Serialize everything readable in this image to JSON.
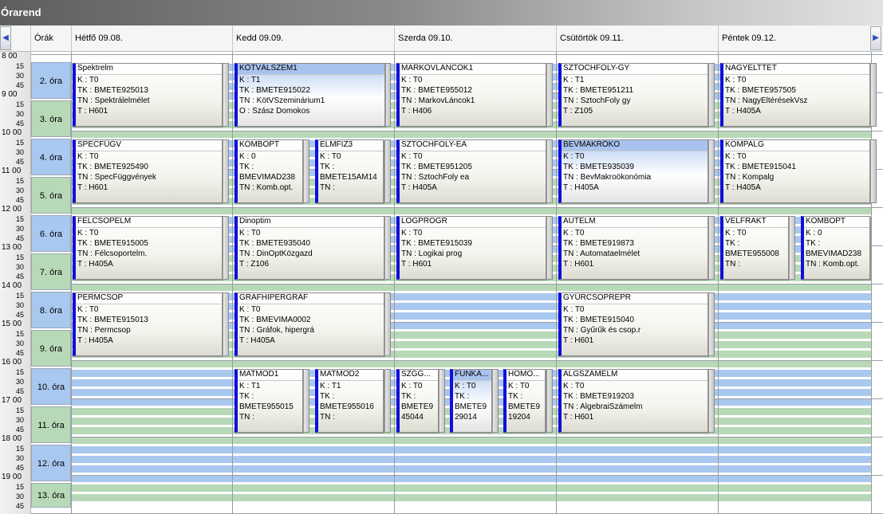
{
  "window": {
    "title": "Órarend"
  },
  "nav": {
    "prev_icon": "◀",
    "next_icon": "▶"
  },
  "header": {
    "corner": "Órák",
    "days": [
      "Hétfő  09.08.",
      "Kedd  09.09.",
      "Szerda  09.10.",
      "Csütörtök  09.11.",
      "Péntek  09.12."
    ]
  },
  "time_labels": [
    {
      "label": "8 00",
      "sub": [
        "15",
        "30",
        "45"
      ]
    },
    {
      "label": "9 00",
      "sub": [
        "15",
        "30",
        "45"
      ]
    },
    {
      "label": "10 00",
      "sub": [
        "15",
        "30",
        "45"
      ]
    },
    {
      "label": "11 00",
      "sub": [
        "15",
        "30",
        "45"
      ]
    },
    {
      "label": "12 00",
      "sub": [
        "15",
        "30",
        "45"
      ]
    },
    {
      "label": "13 00",
      "sub": [
        "15",
        "30",
        "45"
      ]
    },
    {
      "label": "14 00",
      "sub": [
        "15",
        "30",
        "45"
      ]
    },
    {
      "label": "15 00",
      "sub": [
        "15",
        "30",
        "45"
      ]
    },
    {
      "label": "16 00",
      "sub": [
        "15",
        "30",
        "45"
      ]
    },
    {
      "label": "17 00",
      "sub": [
        "15",
        "30",
        "45"
      ]
    },
    {
      "label": "18 00",
      "sub": [
        "15",
        "30",
        "45"
      ]
    },
    {
      "label": "19 00",
      "sub": [
        "15",
        "30",
        "45"
      ]
    }
  ],
  "periods": [
    "2. óra",
    "3. óra",
    "4. óra",
    "5. óra",
    "6. óra",
    "7. óra",
    "8. óra",
    "9. óra",
    "10. óra",
    "11. óra",
    "12. óra",
    "13. óra"
  ],
  "colors": {
    "period_blue": "#a9c8ef",
    "period_green": "#b7d9b8",
    "band_blue": "#a9c8ef",
    "band_green": "#b7d9b8",
    "accent": "#1010d8",
    "selected": "#a9c3ef"
  },
  "events": [
    {
      "title": "Spektrelm",
      "lines": [
        "K : T0",
        "TK : BMETE925013",
        "TN : Spektrálelmélet",
        "T : H601"
      ],
      "selected": false
    },
    {
      "title": "KÖTVÁLSZEM1",
      "lines": [
        "K : T1",
        "TK : BMETE915022",
        "TN : KötVSzeminárium1",
        "O : Szász Domokos"
      ],
      "selected": true
    },
    {
      "title": "MARKOVLÁNCOK1",
      "lines": [
        "K : T0",
        "TK : BMETE955012",
        "TN : MarkovLáncok1",
        "T : H406"
      ],
      "selected": false
    },
    {
      "title": "SZTOCHFOLY-GY",
      "lines": [
        "K : T1",
        "TK : BMETE951211",
        "TN : SztochFoly gy",
        "T : Z105"
      ],
      "selected": false
    },
    {
      "title": "NAGYELTTÉT",
      "lines": [
        "K : T0",
        "TK : BMETE957505",
        "TN : NagyEltérésekVsz",
        "T : H405A"
      ],
      "selected": false
    },
    {
      "title": "SPECFÜGV",
      "lines": [
        "K : T0",
        "TK : BMETE925490",
        "TN : SpecFüggvények",
        "T : H601"
      ],
      "selected": false
    },
    {
      "title": "KOMBOPT",
      "lines": [
        "K : 0",
        "TK :",
        "BMEVIMAD238",
        "TN : Komb.opt."
      ],
      "selected": false
    },
    {
      "title": "ELMFIZ3",
      "lines": [
        "K : T0",
        "TK :",
        "BMETE15AM14",
        "TN :"
      ],
      "selected": false
    },
    {
      "title": "SZTOCHFOLY-EA",
      "lines": [
        "K : T0",
        "TK : BMETE951205",
        "TN : SztochFoly ea",
        "T : H405A"
      ],
      "selected": false
    },
    {
      "title": "BEVMAKRÖKO",
      "lines": [
        "K : T0",
        "TK : BMETE935039",
        "TN : BevMakroökonómia",
        "T : H405A"
      ],
      "selected": true
    },
    {
      "title": "KOMPALG",
      "lines": [
        "K : T0",
        "TK : BMETE915041",
        "TN : Kompalg",
        "T : H405A"
      ],
      "selected": false
    },
    {
      "title": "FÉLCSOPELM",
      "lines": [
        "K : T0",
        "TK : BMETE915005",
        "TN : Félcsoportelm.",
        "T : H405A"
      ],
      "selected": false
    },
    {
      "title": "Dinoptim",
      "lines": [
        "K : T0",
        "TK : BMETE935040",
        "TN : DinOptKözgazd",
        "T : Z106"
      ],
      "selected": false
    },
    {
      "title": "LOGPROGR",
      "lines": [
        "K : T0",
        "TK : BMETE915039",
        "TN : Logikai prog",
        "T : H601"
      ],
      "selected": false
    },
    {
      "title": "AUTELM",
      "lines": [
        "K : T0",
        "TK : BMETE919873",
        "TN : Automataelmélet",
        "T : H601"
      ],
      "selected": false
    },
    {
      "title": "VÉLFRAKT",
      "lines": [
        "K : T0",
        "TK :",
        "BMETE955008",
        "TN :"
      ],
      "selected": false
    },
    {
      "title": "KOMBOPT",
      "lines": [
        "K : 0",
        "TK :",
        "BMEVIMAD238",
        "TN : Komb.opt."
      ],
      "selected": false
    },
    {
      "title": "PERMCSOP",
      "lines": [
        "K : T0",
        "TK : BMETE915013",
        "TN : Permcsop",
        "T : H405A"
      ],
      "selected": false
    },
    {
      "title": "GRÁFHIPERGRÁF",
      "lines": [
        "K : T0",
        "TK : BMEVIMA0002",
        "TN : Gráfok, hipergrá",
        "T : H405A"
      ],
      "selected": false
    },
    {
      "title": "GYÜRCSOPREPR",
      "lines": [
        "K : T0",
        "TK : BMETE915040",
        "TN : Gyűrűk és csop.r",
        "T : H601"
      ],
      "selected": false
    },
    {
      "title": "MATMOD1",
      "lines": [
        "K : T1",
        "TK :",
        "BMETE955015",
        "TN :"
      ],
      "selected": false
    },
    {
      "title": "MATMOD2",
      "lines": [
        "K : T1",
        "TK :",
        "BMETE955016",
        "TN :"
      ],
      "selected": false
    },
    {
      "title": "SZGG...",
      "lines": [
        "K : T0",
        "TK :",
        "BMETE9",
        "45044"
      ],
      "selected": false
    },
    {
      "title": "FUNKA...",
      "lines": [
        "K : T0",
        "TK :",
        "BMETE9",
        "29014"
      ],
      "selected": true
    },
    {
      "title": "HOMO...",
      "lines": [
        "K : T0",
        "TK :",
        "BMETE9",
        "19204"
      ],
      "selected": false
    },
    {
      "title": "ALGSZÁMELM",
      "lines": [
        "K : T0",
        "TK : BMETE919203",
        "TN : AlgebraiSzámelm",
        "T : H601"
      ],
      "selected": false
    }
  ]
}
